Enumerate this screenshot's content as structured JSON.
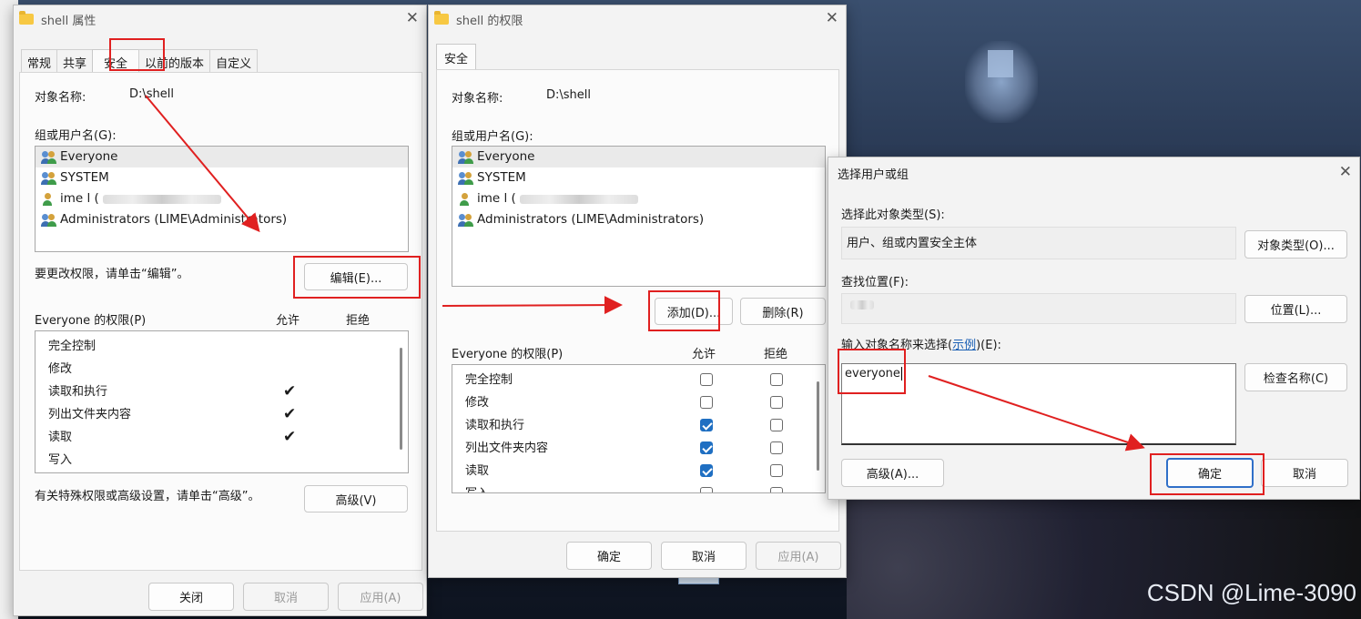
{
  "desktop": {
    "watermark": "CSDN @Lime-3090"
  },
  "props": {
    "title": "shell 属性",
    "tabs": [
      "常规",
      "共享",
      "安全",
      "以前的版本",
      "自定义"
    ],
    "object_label": "对象名称:",
    "object_value": "D:\\shell",
    "group_label": "组或用户名(G):",
    "users": [
      "Everyone",
      "SYSTEM",
      "ime l (",
      "Administrators (LIME\\Administrators)"
    ],
    "change_hint": "要更改权限，请单击“编辑”。",
    "edit_btn": "编辑(E)...",
    "perm_label": "Everyone 的权限(P)",
    "allow": "允许",
    "deny": "拒绝",
    "perms": [
      "完全控制",
      "修改",
      "读取和执行",
      "列出文件夹内容",
      "读取",
      "写入"
    ],
    "allowed": [
      false,
      false,
      true,
      true,
      true,
      false
    ],
    "adv_hint": "有关特殊权限或高级设置，请单击“高级”。",
    "adv_btn": "高级(V)",
    "close_btn": "关闭",
    "cancel_btn": "取消",
    "apply_btn": "应用(A)"
  },
  "perms_win": {
    "title": "shell 的权限",
    "tab": "安全",
    "object_label": "对象名称:",
    "object_value": "D:\\shell",
    "group_label": "组或用户名(G):",
    "users": [
      "Everyone",
      "SYSTEM",
      "ime l (",
      "Administrators (LIME\\Administrators)"
    ],
    "add_btn": "添加(D)...",
    "remove_btn": "删除(R)",
    "perm_label": "Everyone 的权限(P)",
    "allow": "允许",
    "deny": "拒绝",
    "perms": [
      "完全控制",
      "修改",
      "读取和执行",
      "列出文件夹内容",
      "读取",
      "写入"
    ],
    "allowed": [
      false,
      false,
      true,
      true,
      true,
      false
    ],
    "ok_btn": "确定",
    "cancel_btn": "取消",
    "apply_btn": "应用(A)"
  },
  "select_dlg": {
    "title": "选择用户或组",
    "type_label": "选择此对象类型(S):",
    "type_value": "用户、组或内置安全主体",
    "type_btn": "对象类型(O)...",
    "loc_label": "查找位置(F):",
    "loc_value": "",
    "loc_btn": "位置(L)...",
    "name_label_pre": "输入对象名称来选择(",
    "name_label_link": "示例",
    "name_label_post": ")(E):",
    "name_value": "everyone",
    "check_btn": "检查名称(C)",
    "adv_btn": "高级(A)...",
    "ok_btn": "确定",
    "cancel_btn": "取消"
  },
  "colors": {
    "accent": "#1f6fc2",
    "annotation": "#e02020"
  }
}
